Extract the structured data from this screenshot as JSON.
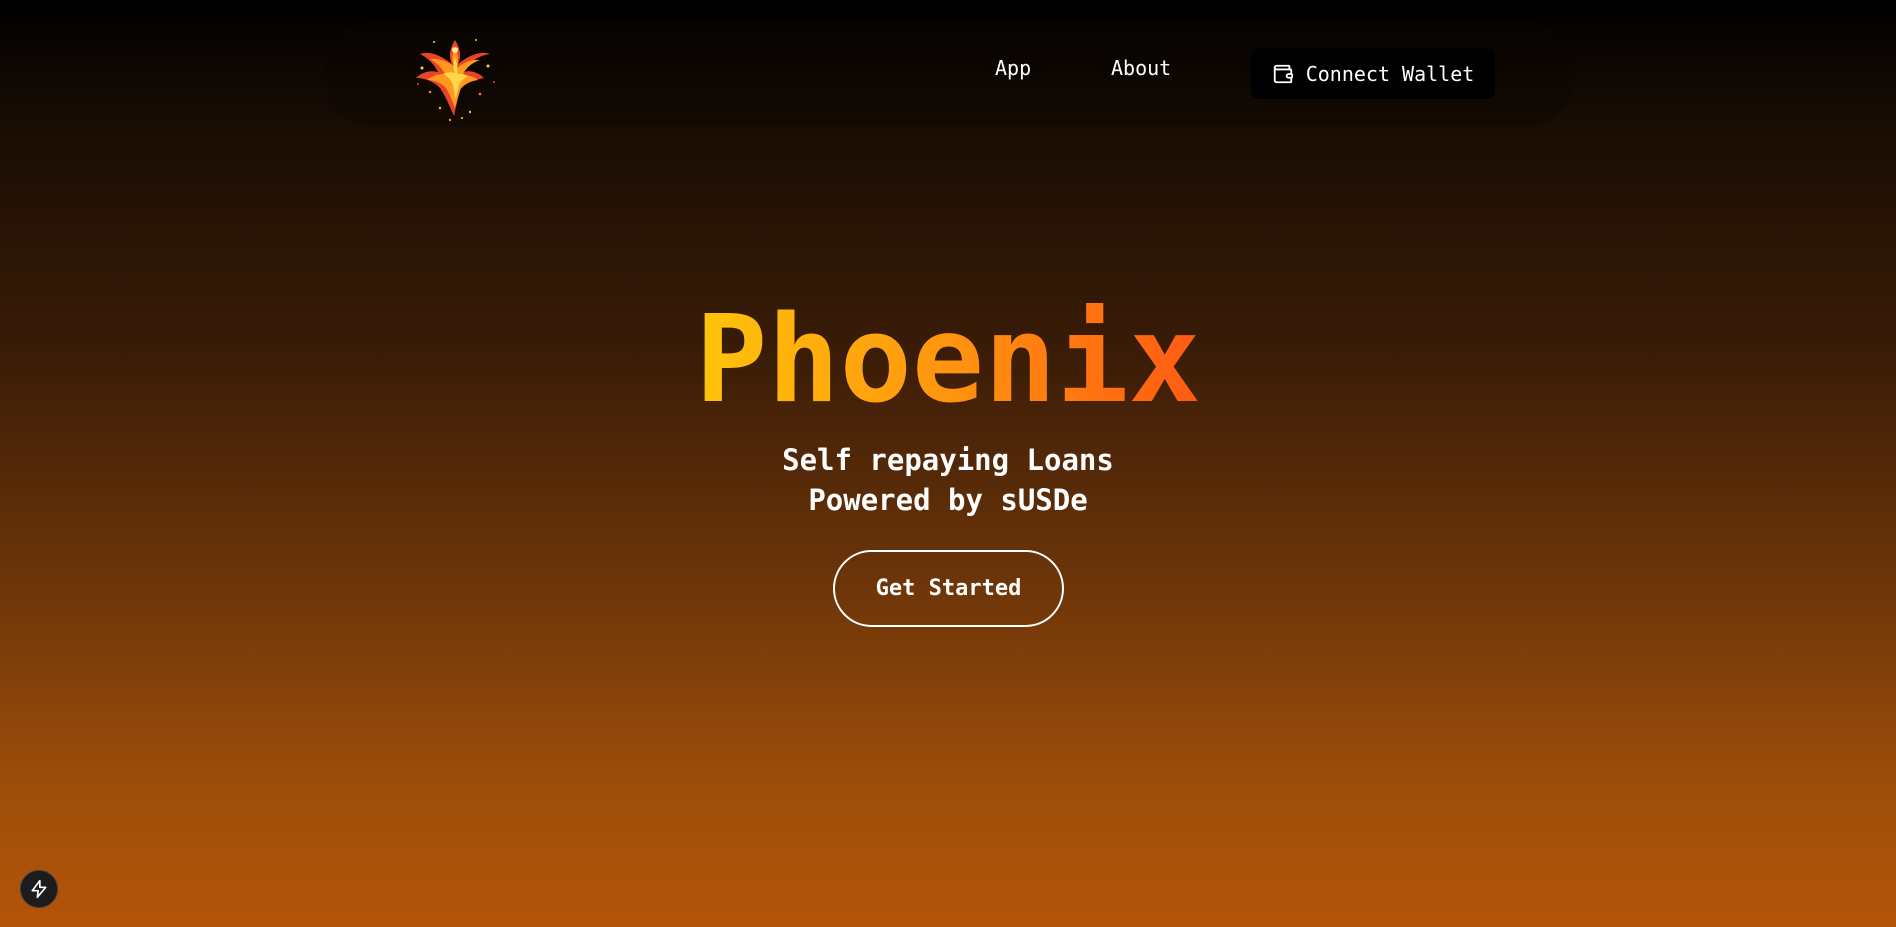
{
  "nav": {
    "logo_icon": "phoenix-logo",
    "links": [
      "App",
      "About"
    ],
    "wallet_label": "Connect Wallet",
    "wallet_icon": "wallet-icon"
  },
  "hero": {
    "title": "Phoenix",
    "subtitle_line1": "Self repaying Loans",
    "subtitle_line2": "Powered by sUSDe",
    "cta_label": "Get Started"
  },
  "widget": {
    "icon": "lightning-bolt-icon"
  },
  "colors": {
    "title_gradient_start": "#ffc40a",
    "title_gradient_end": "#ff5a12",
    "background_top": "#000000",
    "background_bottom": "#b3540a"
  }
}
